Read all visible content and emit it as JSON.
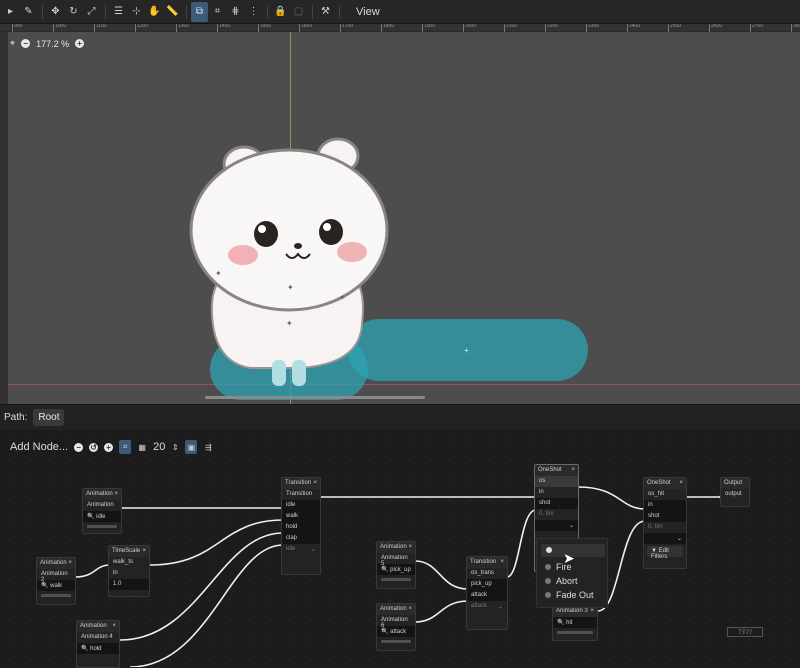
{
  "toolbar": {
    "view_label": "View"
  },
  "viewport": {
    "zoom_label": "177.2 %",
    "ruler_marks": [
      "900",
      "1000",
      "1100",
      "1200",
      "1300",
      "1400",
      "1500",
      "1600",
      "1700",
      "1800",
      "1900",
      "2000",
      "2100",
      "2200",
      "2300",
      "2400",
      "2500",
      "2600",
      "2700",
      "2800"
    ]
  },
  "pathbar": {
    "label": "Path:",
    "root": "Root"
  },
  "graph": {
    "add_node": "Add Node...",
    "snap_value": "20"
  },
  "nodes": {
    "anim1": {
      "title": "Animation",
      "out": "Animation",
      "clip": "idle"
    },
    "anim2": {
      "title": "Animation",
      "out": "Animation 2",
      "clip": "walk"
    },
    "timescale": {
      "title": "TimeScale",
      "out": "walk_ts",
      "in": "in",
      "val": "1.0"
    },
    "anim4": {
      "title": "Animation",
      "out": "Animation 4",
      "clip": "hold"
    },
    "transition1": {
      "title": "Transition",
      "out": "Transition",
      "ports": [
        "idle",
        "walk",
        "hold",
        "clap",
        "idle"
      ]
    },
    "anim5": {
      "title": "Animation",
      "out": "Animation 5",
      "clip": "pick_up"
    },
    "anim6": {
      "title": "Animation",
      "out": "Animation 6",
      "clip": "attack"
    },
    "transition2": {
      "title": "Transition",
      "out": "os_trans",
      "ports": [
        "pick_up",
        "attack",
        "attack"
      ]
    },
    "oneshot1": {
      "title": "OneShot",
      "out": "os",
      "ports": [
        "in",
        "shot"
      ],
      "filters": "Edit Filters"
    },
    "oneshot2": {
      "title": "OneShot",
      "out": "os_hit",
      "ports": [
        "in",
        "shot"
      ],
      "filters": "Edit Filters"
    },
    "anim3": {
      "title": "Animation 3",
      "clip": "hit"
    },
    "output": {
      "title": "Output",
      "port": "output"
    }
  },
  "popup": {
    "items": [
      "Fire",
      "Abort",
      "Fade Out"
    ]
  },
  "watermark": "7ﾀﾏﾂ"
}
